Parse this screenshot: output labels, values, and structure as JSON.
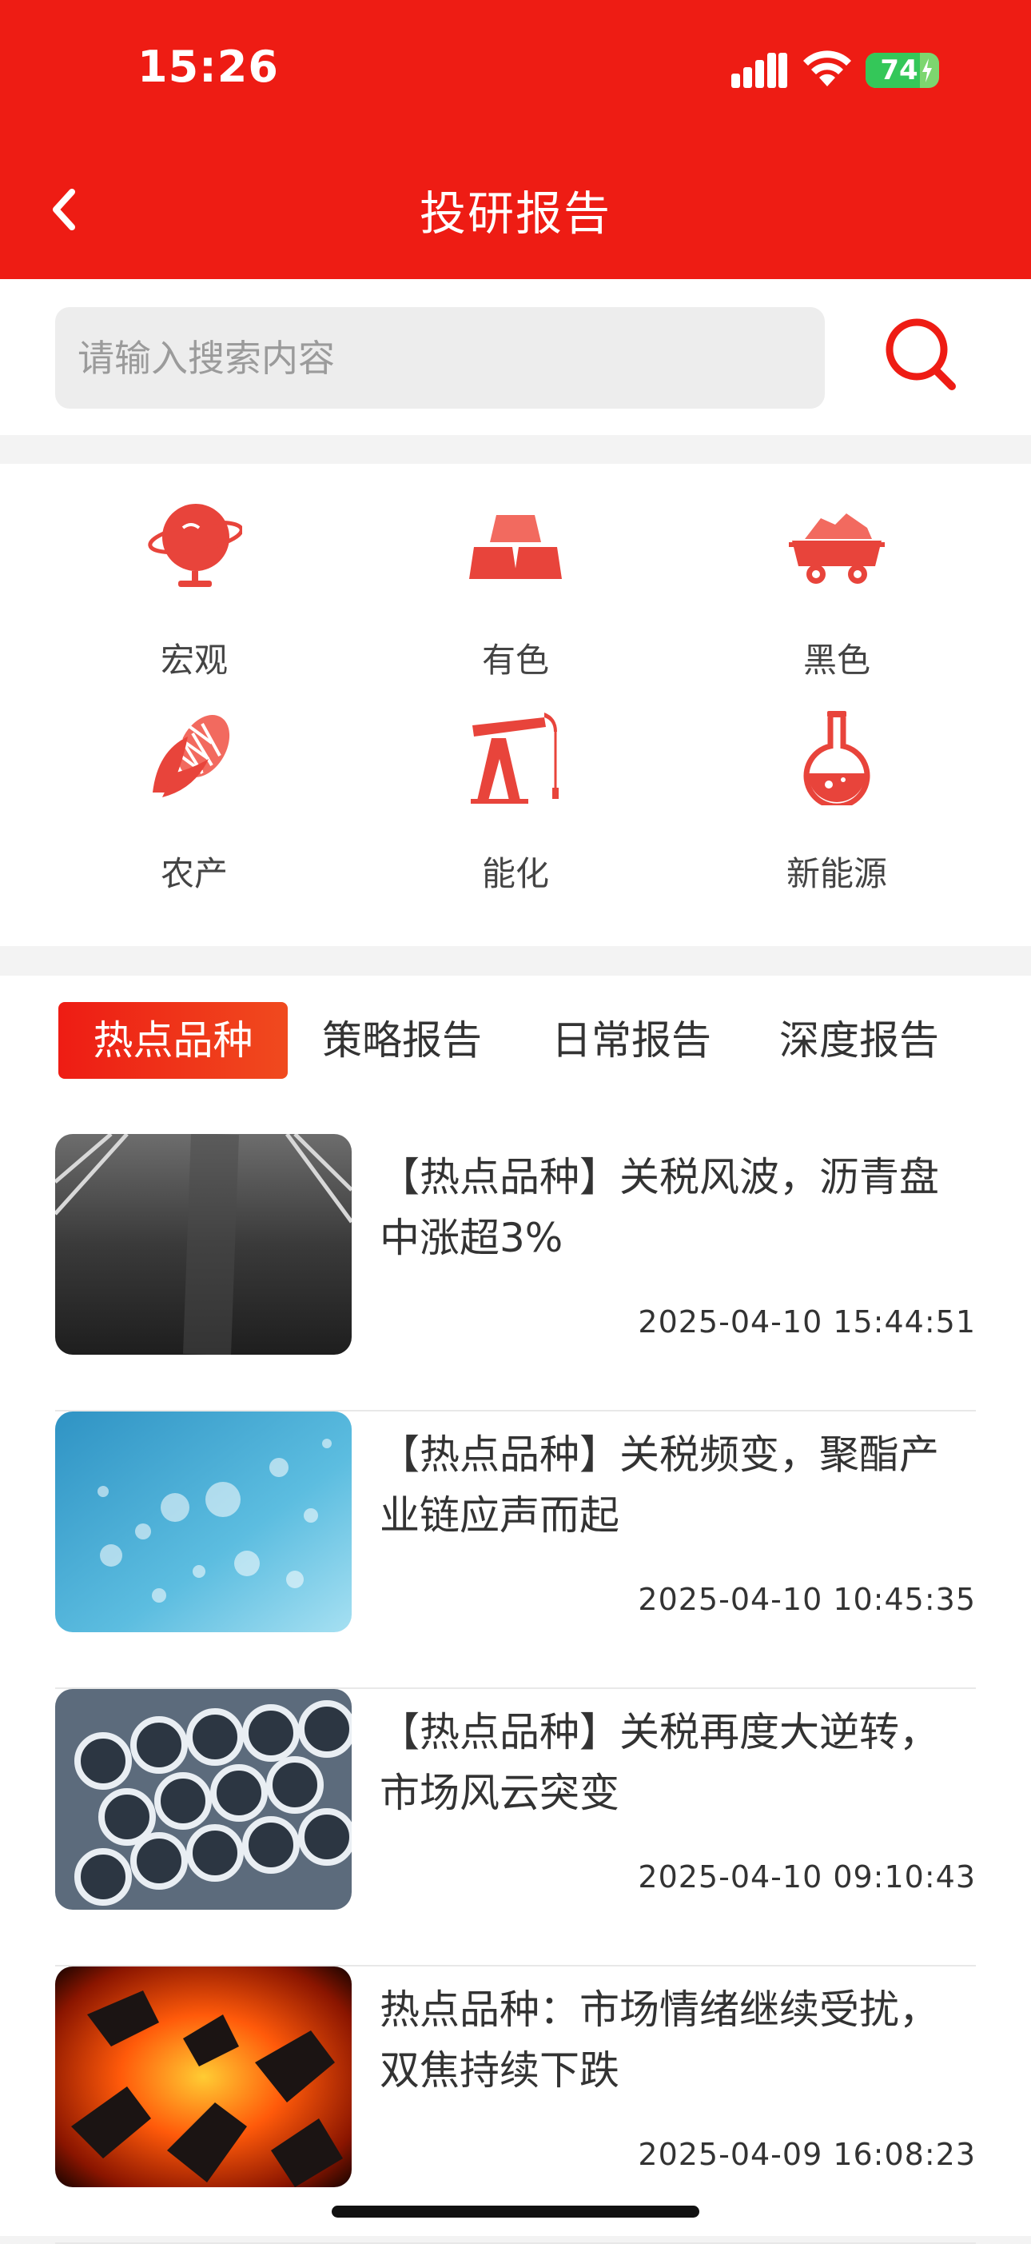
{
  "status_bar": {
    "time": "15:26",
    "battery": "74",
    "battery_level": 0.74
  },
  "header": {
    "title": "投研报告",
    "background": "#ee1c14"
  },
  "search": {
    "placeholder": "请输入搜索内容"
  },
  "categories": [
    {
      "label": "宏观",
      "icon": "globe-icon"
    },
    {
      "label": "有色",
      "icon": "gold-bars-icon"
    },
    {
      "label": "黑色",
      "icon": "coal-cart-icon"
    },
    {
      "label": "农产",
      "icon": "corn-icon"
    },
    {
      "label": "能化",
      "icon": "oil-pump-icon"
    },
    {
      "label": "新能源",
      "icon": "flask-icon"
    }
  ],
  "tabs": [
    {
      "label": "热点品种",
      "active": true
    },
    {
      "label": "策略报告",
      "active": false
    },
    {
      "label": "日常报告",
      "active": false
    },
    {
      "label": "深度报告",
      "active": false
    }
  ],
  "articles": [
    {
      "title": "【热点品种】关税风波，沥青盘中涨超3%",
      "time": "2025-04-10 15:44:51",
      "image": "asphalt-road-image"
    },
    {
      "title": "【热点品种】关税频变，聚酯产业链应声而起",
      "time": "2025-04-10 10:45:35",
      "image": "water-bubbles-image"
    },
    {
      "title": "【热点品种】关税再度大逆转，市场风云突变",
      "time": "2025-04-10 09:10:43",
      "image": "steel-pipes-image"
    },
    {
      "title": "热点品种：市场情绪继续受扰，双焦持续下跌",
      "time": "2025-04-09 16:08:23",
      "image": "burning-coal-image"
    }
  ],
  "colors": {
    "accent": "#ee1c14",
    "icon": "#e8443b"
  }
}
